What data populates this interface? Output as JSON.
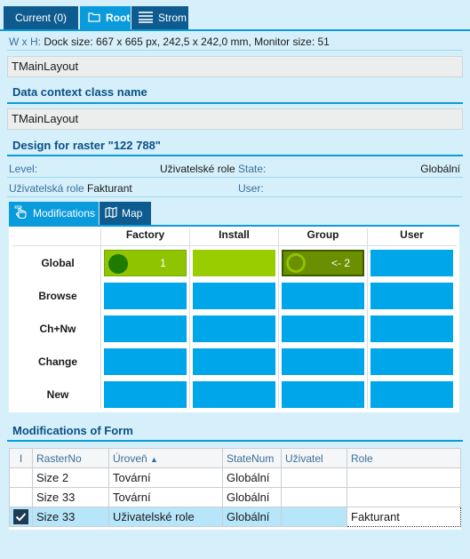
{
  "tabs": {
    "current": "Current (0)",
    "root": "Root",
    "strom": "Strom"
  },
  "dock_info": {
    "label": "W x H:",
    "value": "Dock size: 667 x 665 px, 242,5 x 242,0 mm, Monitor size: 51"
  },
  "layout_name": "TMainLayout",
  "data_context": {
    "title": "Data context class name",
    "value": "TMainLayout"
  },
  "design": {
    "title": "Design for raster \"122 788\"",
    "level_label": "Level:",
    "level_value": "Uživatelské role",
    "state_label": "State:",
    "state_value": "Globální",
    "role_label": "Uživatelská role",
    "role_value": "Fakturant",
    "user_label": "User:",
    "user_value": ""
  },
  "inner_tabs": {
    "modifications": "Modifications",
    "map": "Map"
  },
  "grid": {
    "columns": [
      "Factory",
      "Install",
      "Group",
      "User"
    ],
    "rows": [
      "Global",
      "Browse",
      "Ch+Nw",
      "Change",
      "New"
    ],
    "global_factory_text": "1",
    "global_group_text": "<- 2",
    "colors": {
      "default": "#00a6ea",
      "factory_active": "#8fc400",
      "install_active": "#9acd00",
      "group_active": "#6a8f00",
      "circle": "#1f7a00"
    }
  },
  "modifications_of_form": {
    "title": "Modifications of Form",
    "headers": [
      "I",
      "RasterNo",
      "Úroveň",
      "StateNum",
      "Uživatel",
      "Role"
    ],
    "rows": [
      {
        "checked": false,
        "raster": "Size 2",
        "uroven": "Tovární",
        "state": "Globální",
        "user": "",
        "role": ""
      },
      {
        "checked": false,
        "raster": "Size 33",
        "uroven": "Tovární",
        "state": "Globální",
        "user": "",
        "role": ""
      },
      {
        "checked": true,
        "raster": "Size 33",
        "uroven": "Uživatelské role",
        "state": "Globální",
        "user": "",
        "role": "Fakturant"
      }
    ]
  }
}
